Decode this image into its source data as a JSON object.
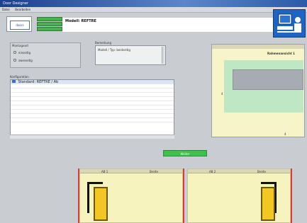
{
  "window": {
    "title": "Door Designer"
  },
  "menu": [
    "Datei",
    "Bearbeiten"
  ],
  "header": {
    "logo_text": "doors",
    "product_title": "Modell: REFTRE",
    "green_fields": [
      "",
      "",
      ""
    ]
  },
  "left_panel": {
    "mounting_label": "Montageart",
    "options": [
      "einseitig",
      "zweiseitig"
    ],
    "remarks_label": "Bemerkung",
    "remarks_value": "Modell / Typ: beidseitig",
    "list_label": "Konfiguration",
    "list_items": [
      "Standard: REFTRE / Ab"
    ]
  },
  "preview": {
    "title": "Rahmenansicht 1",
    "dimension_x": "4",
    "dimension_y": "4"
  },
  "actions": {
    "primary": "Weiter"
  },
  "cards": [
    {
      "label_left": "AB 1",
      "label_right": "Breite"
    },
    {
      "label_left": "AB 2",
      "label_right": "Breite"
    }
  ],
  "colors": {
    "titlebar": "#1d3f8f",
    "accent_green": "#48b04f",
    "preview_yellow": "#f7f5c8",
    "door_yellow": "#f2c623"
  }
}
